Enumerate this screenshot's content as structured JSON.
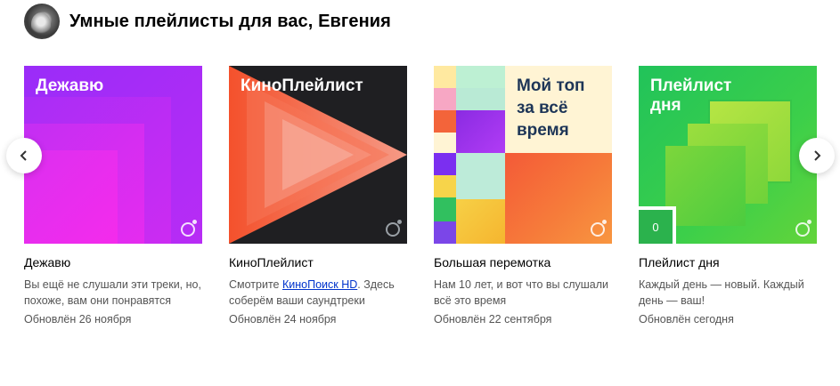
{
  "header": {
    "title": "Умные плейлисты для вас, Евгения"
  },
  "cards": [
    {
      "cover_title": "Дежавю",
      "name": "Дежавю",
      "description": "Вы ещё не слушали эти треки, но, похоже, вам они понравятся",
      "updated": "Обновлён 26 ноября"
    },
    {
      "cover_title": "КиноПлейлист",
      "name": "КиноПлейлист",
      "description_prefix": "Смотрите ",
      "description_link": "КиноПоиск HD",
      "description_suffix": ". Здесь соберём ваши саундтреки",
      "updated": "Обновлён 24 ноября"
    },
    {
      "cover_title_1": "Мой топ",
      "cover_title_2": "за всё",
      "cover_title_3": "время",
      "name": "Большая перемотка",
      "description": "Нам 10 лет, и вот что вы слушали всё это время",
      "updated": "Обновлён 22 сентября"
    },
    {
      "cover_title_1": "Плейлист",
      "cover_title_2": "дня",
      "cover_badge": "0",
      "name": "Плейлист дня",
      "description": "Каждый день — новый. Каждый день — ваш!",
      "updated": "Обновлён сегодня"
    }
  ],
  "nav": {
    "prev_icon": "chevron-left-icon",
    "next_icon": "chevron-right-icon"
  }
}
